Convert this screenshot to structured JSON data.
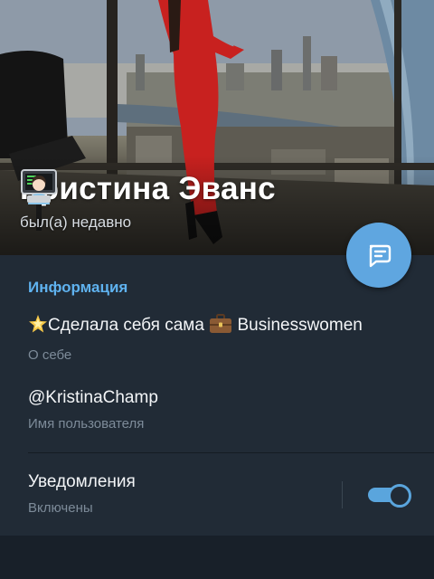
{
  "profile": {
    "name": "Кристина Эванс",
    "name_emoji": "woman-technologist-emoji",
    "status": "был(а) недавно"
  },
  "fab": {
    "icon": "message-icon"
  },
  "info": {
    "section_title": "Информация",
    "bio": {
      "prefix_emoji": "glowing-star-emoji",
      "text_part1": "Сделала себя сама ",
      "middle_emoji": "briefcase-emoji",
      "text_part2": " Businesswomen",
      "label": "О себе"
    },
    "username": {
      "value": "@KristinaChamp",
      "label": "Имя пользователя"
    },
    "notifications": {
      "title": "Уведомления",
      "status": "Включены",
      "enabled": true
    }
  },
  "colors": {
    "accent": "#5fa6e0",
    "section_title": "#5fb2ef",
    "panel_bg": "#212b36",
    "page_bg": "#182029",
    "secondary_text": "#7d8b99"
  }
}
